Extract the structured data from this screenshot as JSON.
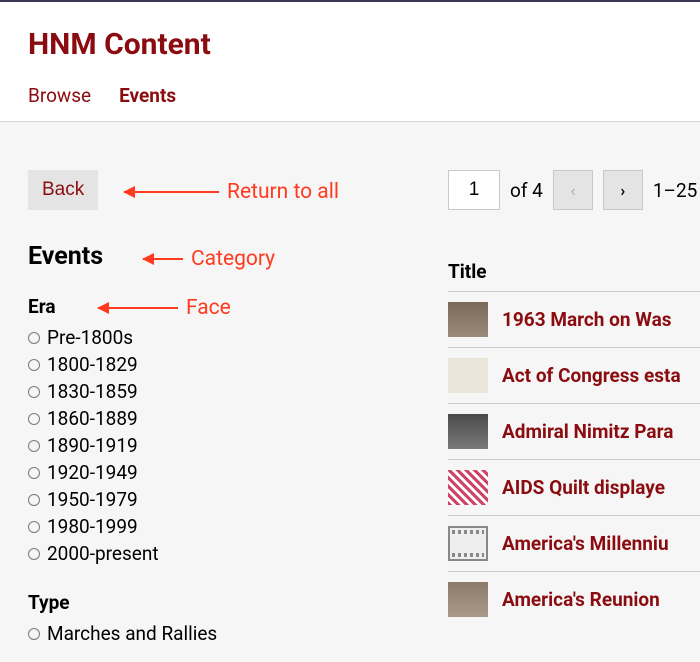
{
  "header": {
    "site_title": "HNM Content",
    "tabs": [
      {
        "label": "Browse",
        "active": false
      },
      {
        "label": "Events",
        "active": true
      }
    ]
  },
  "back_label": "Back",
  "category_title": "Events",
  "facets": [
    {
      "title": "Era",
      "items": [
        "Pre-1800s",
        "1800-1829",
        "1830-1859",
        "1860-1889",
        "1890-1919",
        "1920-1949",
        "1950-1979",
        "1980-1999",
        "2000-present"
      ]
    },
    {
      "title": "Type",
      "items": [
        "Marches and Rallies"
      ]
    }
  ],
  "annotations": {
    "return_to_all": "Return to all",
    "category": "Category",
    "face": "Face"
  },
  "pager": {
    "current": "1",
    "of_label": "of 4",
    "range": "1–25"
  },
  "table": {
    "header": "Title",
    "rows": [
      {
        "title": "1963 March on Was",
        "thumb": "crowd"
      },
      {
        "title": "Act of Congress esta",
        "thumb": "doc"
      },
      {
        "title": "Admiral Nimitz Para",
        "thumb": "car"
      },
      {
        "title": "AIDS Quilt displaye",
        "thumb": "quilt"
      },
      {
        "title": "America's Millenniu",
        "thumb": "film"
      },
      {
        "title": "America's Reunion",
        "thumb": "crowd2"
      }
    ]
  }
}
